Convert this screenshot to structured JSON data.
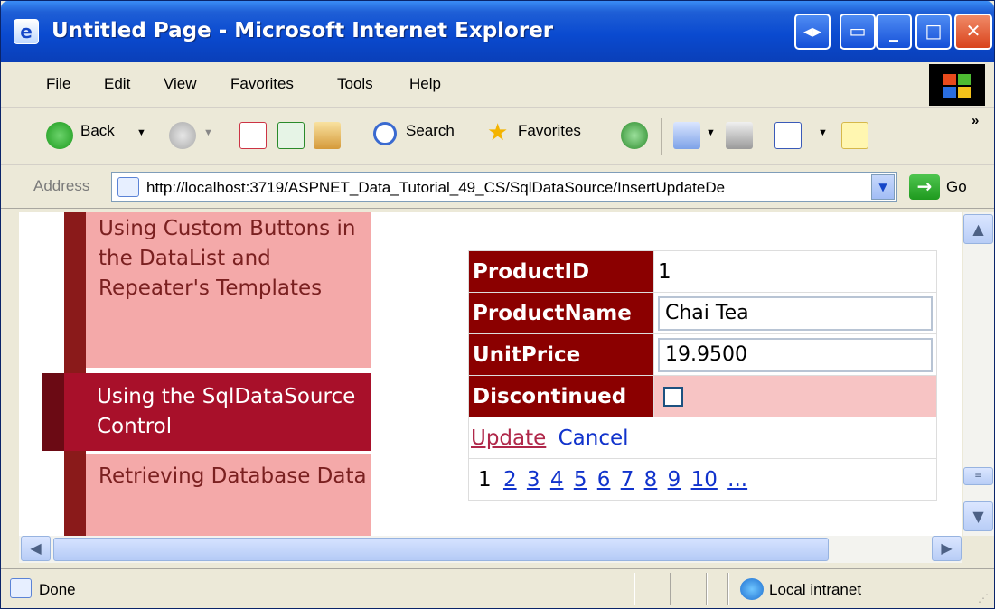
{
  "window": {
    "title": "Untitled Page - Microsoft Internet Explorer"
  },
  "menu": [
    "File",
    "Edit",
    "View",
    "Favorites",
    "Tools",
    "Help"
  ],
  "toolbar": {
    "back_label": "Back",
    "search_label": "Search",
    "favorites_label": "Favorites"
  },
  "address": {
    "label": "Address",
    "url": "http://localhost:3719/ASPNET_Data_Tutorial_49_CS/SqlDataSource/InsertUpdateDe",
    "go_label": "Go"
  },
  "sidebar": {
    "items": [
      {
        "label": "Using Custom Buttons in the DataList and Repeater's Templates"
      },
      {
        "label": "Using the SqlDataSource Control"
      },
      {
        "label": "Retrieving Database Data"
      }
    ]
  },
  "details": {
    "rows": [
      {
        "label": "ProductID",
        "value": "1"
      },
      {
        "label": "ProductName",
        "value": "Chai Tea"
      },
      {
        "label": "UnitPrice",
        "value": "19.9500"
      },
      {
        "label": "Discontinued"
      }
    ],
    "update_label": "Update",
    "cancel_label": "Cancel",
    "current_page": "1",
    "pages": [
      "2",
      "3",
      "4",
      "5",
      "6",
      "7",
      "8",
      "9",
      "10",
      "..."
    ]
  },
  "status": {
    "text": "Done",
    "zone": "Local intranet"
  },
  "colors": {
    "header_bg": "#8b0000",
    "menu_bg": "#f4a9a9",
    "menu_active_bg": "#a8102a",
    "link": "#1133cc"
  }
}
